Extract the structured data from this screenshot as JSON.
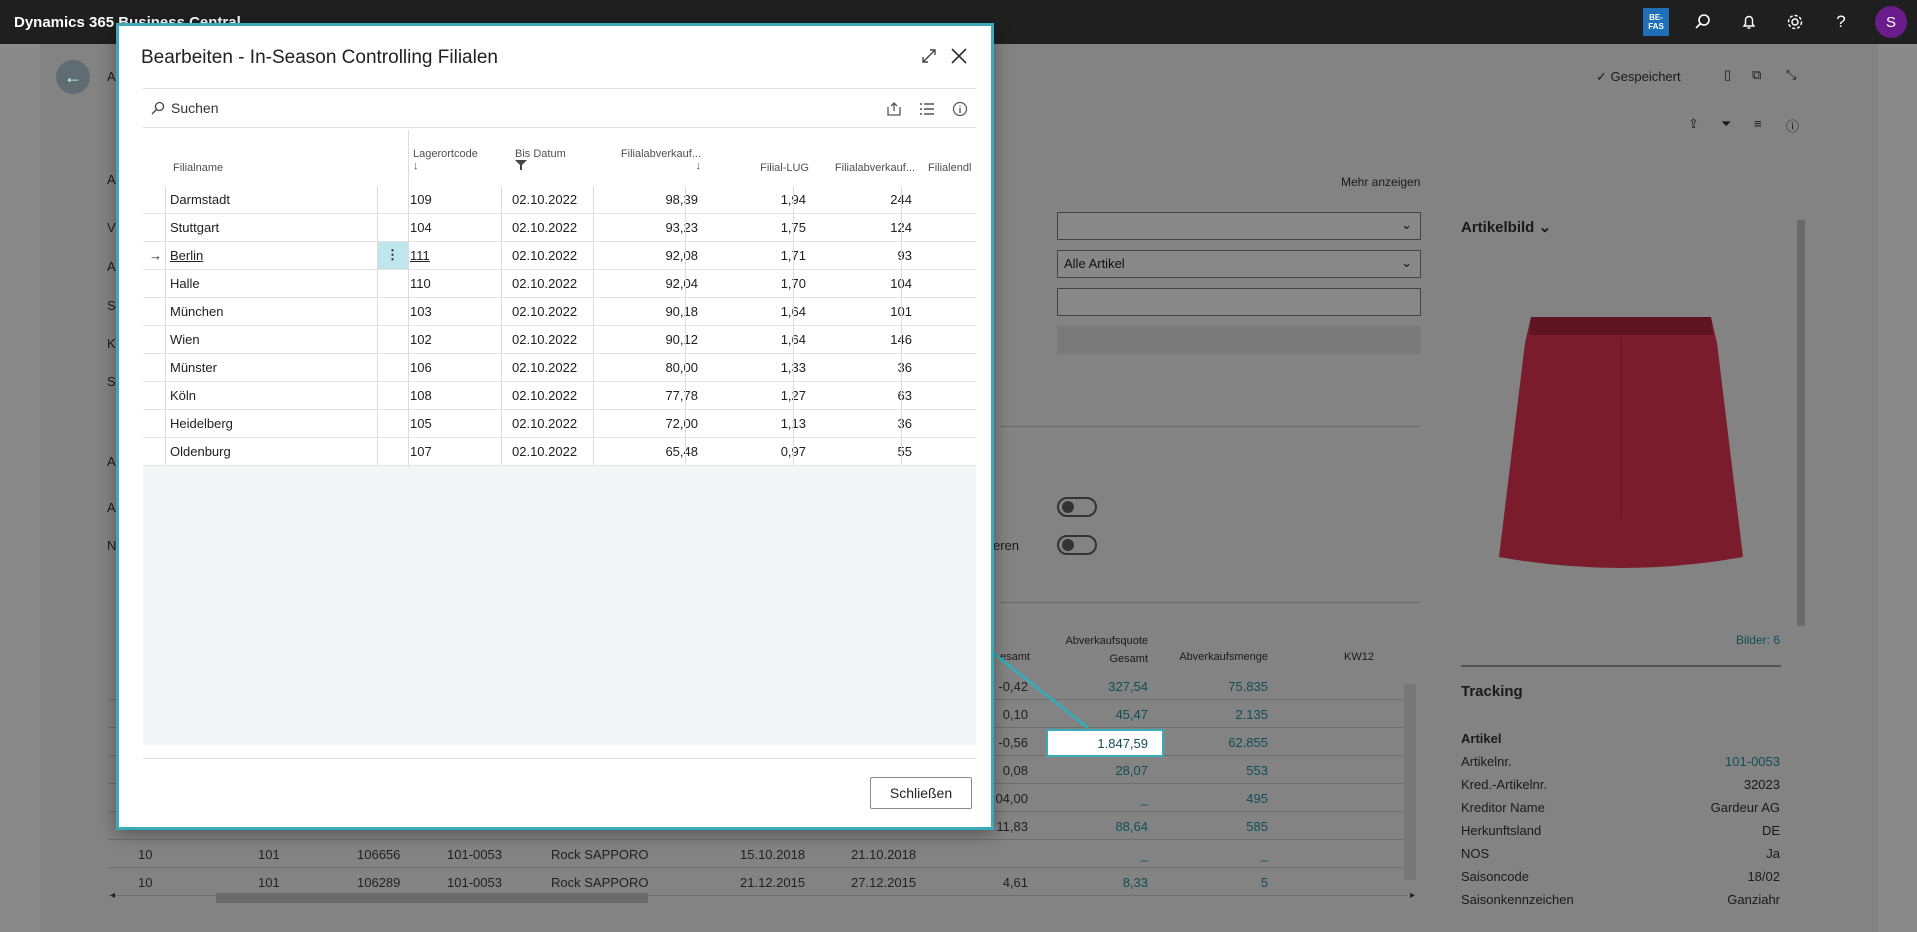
{
  "app": {
    "title": "Dynamics 365 Business Central",
    "env_badge": "BE-\nFAS",
    "avatar_initial": "S"
  },
  "background": {
    "saved_label": "Gespeichert",
    "show_more": "Mehr anzeigen",
    "filter_value": "Alle Artikel",
    "partial_label": "eren",
    "left_letters": [
      "A",
      "A",
      "V",
      "A",
      "S",
      "K",
      "S",
      "A",
      "A",
      "N"
    ],
    "picture_title": "Artikelbild",
    "pictures_count": "Bilder: 6",
    "table_headers": {
      "gesamt": "esamt",
      "quote": "Abverkaufsquote\nGesamt",
      "menge": "Abverkaufsmenge",
      "kw": "KW12"
    },
    "table_rows": [
      {
        "gesamt": "-0,42",
        "quote": "327,54",
        "menge": "75.835"
      },
      {
        "gesamt": "0,10",
        "quote": "45,47",
        "menge": "2.135"
      },
      {
        "gesamt": "-0,56",
        "quote": "1.847,59",
        "menge": "62.855"
      },
      {
        "gesamt": "0,08",
        "quote": "28,07",
        "menge": "553"
      },
      {
        "gesamt": "04,00",
        "quote": "_",
        "menge": "495"
      },
      {
        "gesamt": "11,83",
        "quote": "88,64",
        "menge": "585"
      },
      {
        "c1": "10",
        "c2": "101",
        "c3": "106656",
        "c4": "101-0053",
        "c5": "Rock SAPPORO",
        "c6": "15.10.2018",
        "c7": "21.10.2018",
        "gesamt": "",
        "quote": "_",
        "menge": "_"
      },
      {
        "c1": "10",
        "c2": "101",
        "c3": "106289",
        "c4": "101-0053",
        "c5": "Rock SAPPORO",
        "c6": "21.12.2015",
        "c7": "27.12.2015",
        "gesamt": "4,61",
        "quote": "8,33",
        "menge": "5"
      }
    ],
    "tracking": {
      "title": "Tracking",
      "section": "Artikel",
      "fields": [
        {
          "label": "Artikelnr.",
          "value": "101-0053"
        },
        {
          "label": "Kred.-Artikelnr.",
          "value": "32023"
        },
        {
          "label": "Kreditor Name",
          "value": "Gardeur AG"
        },
        {
          "label": "Herkunftsland",
          "value": "DE"
        },
        {
          "label": "NOS",
          "value": "Ja"
        },
        {
          "label": "Saisoncode",
          "value": "18/02"
        },
        {
          "label": "Saisonkennzeichen",
          "value": "Ganziahr"
        }
      ]
    }
  },
  "dialog": {
    "title": "Bearbeiten - In-Season Controlling Filialen",
    "search_label": "Suchen",
    "close_button": "Schließen",
    "columns": {
      "name": "Filialname",
      "code": "Lagerortcode",
      "date": "Bis Datum",
      "abv1": "Filialabverkauf...",
      "lug": "Filial-LUG",
      "abv2": "Filialabverkauf...",
      "end": "Filialendl"
    },
    "rows": [
      {
        "name": "Darmstadt",
        "code": "109",
        "date": "02.10.2022",
        "abv1": "98,39",
        "lug": "1,94",
        "abv2": "244"
      },
      {
        "name": "Stuttgart",
        "code": "104",
        "date": "02.10.2022",
        "abv1": "93,23",
        "lug": "1,75",
        "abv2": "124"
      },
      {
        "name": "Berlin",
        "code": "111",
        "date": "02.10.2022",
        "abv1": "92,08",
        "lug": "1,71",
        "abv2": "93"
      },
      {
        "name": "Halle",
        "code": "110",
        "date": "02.10.2022",
        "abv1": "92,04",
        "lug": "1,70",
        "abv2": "104"
      },
      {
        "name": "München",
        "code": "103",
        "date": "02.10.2022",
        "abv1": "90,18",
        "lug": "1,64",
        "abv2": "101"
      },
      {
        "name": "Wien",
        "code": "102",
        "date": "02.10.2022",
        "abv1": "90,12",
        "lug": "1,64",
        "abv2": "146"
      },
      {
        "name": "Münster",
        "code": "106",
        "date": "02.10.2022",
        "abv1": "80,00",
        "lug": "1,33",
        "abv2": "36"
      },
      {
        "name": "Köln",
        "code": "108",
        "date": "02.10.2022",
        "abv1": "77,78",
        "lug": "1,27",
        "abv2": "63"
      },
      {
        "name": "Heidelberg",
        "code": "105",
        "date": "02.10.2022",
        "abv1": "72,00",
        "lug": "1,13",
        "abv2": "36"
      },
      {
        "name": "Oldenburg",
        "code": "107",
        "date": "02.10.2022",
        "abv1": "65,48",
        "lug": "0,97",
        "abv2": "55"
      }
    ],
    "selected_row": 2
  },
  "colors": {
    "accent": "#3aa9b8",
    "topbar": "#1f1f1f",
    "teal_link": "#0f7b86"
  }
}
